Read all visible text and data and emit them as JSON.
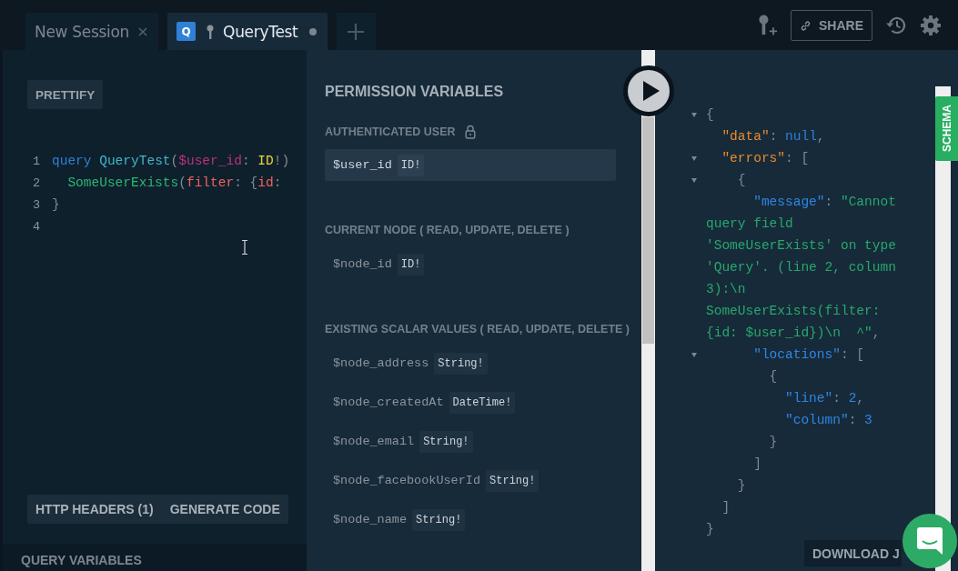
{
  "tabs": [
    {
      "label": "New Session",
      "selected": false,
      "unsaved": false,
      "auth": false
    },
    {
      "label": "QueryTest",
      "selected": true,
      "unsaved": true,
      "auth": true,
      "badge": "Q"
    }
  ],
  "toolbar": {
    "share": "SHARE"
  },
  "editor": {
    "prettify": "PRETTIFY",
    "lines": [
      {
        "number": "1",
        "tokens": [
          {
            "text": "query ",
            "kind": "keyword"
          },
          {
            "text": "QueryTest",
            "kind": "def"
          },
          {
            "text": "(",
            "kind": "punct"
          },
          {
            "text": "$user_id",
            "kind": "variable"
          },
          {
            "text": ": ",
            "kind": "punct"
          },
          {
            "text": "ID",
            "kind": "type"
          },
          {
            "text": "!)",
            "kind": "punct"
          }
        ]
      },
      {
        "number": "2",
        "tokens": [
          {
            "text": "  SomeUserExists",
            "kind": "field"
          },
          {
            "text": "(",
            "kind": "punct"
          },
          {
            "text": "filter",
            "kind": "attribute"
          },
          {
            "text": ": {",
            "kind": "punct"
          },
          {
            "text": "id",
            "kind": "attribute"
          },
          {
            "text": ":",
            "kind": "punct"
          }
        ]
      },
      {
        "number": "3",
        "tokens": [
          {
            "text": "}",
            "kind": "punct"
          }
        ]
      },
      {
        "number": "4"
      }
    ],
    "bottom_buttons": [
      "HTTP HEADERS (1)",
      "GENERATE CODE"
    ],
    "query_variables": "QUERY VARIABLES"
  },
  "permissions": {
    "title": "PERMISSION VARIABLES",
    "sections": [
      {
        "label": "AUTHENTICATED USER",
        "locked": true,
        "variables": [
          {
            "name": "$user_id",
            "type": "ID!",
            "selected": true
          }
        ]
      },
      {
        "label": "CURRENT NODE ( **READ, UPDATE, DELETE** )",
        "locked": false,
        "variables": [
          {
            "name": "$node_id",
            "type": "ID!",
            "selected": false
          }
        ]
      },
      {
        "label": "EXISTING SCALAR VALUES ( **READ, UPDATE, DELETE** )",
        "locked": false,
        "variables": [
          {
            "name": "$node_address",
            "type": "String!",
            "selected": false
          },
          {
            "name": "$node_createdAt",
            "type": "DateTime!",
            "selected": false
          },
          {
            "name": "$node_email",
            "type": "String!",
            "selected": false
          },
          {
            "name": "$node_facebookUserId",
            "type": "String!",
            "selected": false
          },
          {
            "name": "$node_name",
            "type": "String!",
            "selected": false
          }
        ]
      }
    ]
  },
  "result": {
    "schema_tab": "SCHEMA",
    "download": "DOWNLOAD J",
    "lines": [
      {
        "foldable": true,
        "tokens": [
          {
            "text": "{",
            "kind": "punct"
          }
        ]
      },
      {
        "foldable": false,
        "tokens": [
          {
            "text": "  \"data\"",
            "kind": "key"
          },
          {
            "text": ": ",
            "kind": "punct"
          },
          {
            "text": "null",
            "kind": "keyword"
          },
          {
            "text": ",",
            "kind": "punct"
          }
        ]
      },
      {
        "foldable": true,
        "tokens": [
          {
            "text": "  \"errors\"",
            "kind": "key"
          },
          {
            "text": ": [",
            "kind": "punct"
          }
        ]
      },
      {
        "foldable": true,
        "tokens": [
          {
            "text": "    {",
            "kind": "punct"
          }
        ]
      },
      {
        "foldable": false,
        "tokens": [
          {
            "text": "      \"message\"",
            "kind": "nested-key"
          },
          {
            "text": ": ",
            "kind": "punct"
          },
          {
            "text": "\"Cannot",
            "kind": "string"
          }
        ]
      },
      {
        "foldable": false,
        "tokens": [
          {
            "text": "query field",
            "kind": "string"
          }
        ]
      },
      {
        "foldable": false,
        "tokens": [
          {
            "text": "'SomeUserExists' on type",
            "kind": "string"
          }
        ]
      },
      {
        "foldable": false,
        "tokens": [
          {
            "text": "'Query'. (line 2, column",
            "kind": "string"
          }
        ]
      },
      {
        "foldable": false,
        "tokens": [
          {
            "text": "3):\\n",
            "kind": "string"
          }
        ]
      },
      {
        "foldable": false,
        "tokens": [
          {
            "text": "SomeUserExists(filter:",
            "kind": "string"
          }
        ]
      },
      {
        "foldable": false,
        "tokens": [
          {
            "text": "{id: $user_id})\\n  ^\"",
            "kind": "string"
          },
          {
            "text": ",",
            "kind": "punct"
          }
        ]
      },
      {
        "foldable": true,
        "tokens": [
          {
            "text": "      \"locations\"",
            "kind": "nested-key"
          },
          {
            "text": ": [",
            "kind": "punct"
          }
        ]
      },
      {
        "foldable": false,
        "tokens": [
          {
            "text": "        {",
            "kind": "punct"
          }
        ]
      },
      {
        "foldable": false,
        "tokens": [
          {
            "text": "          \"line\"",
            "kind": "nested-key"
          },
          {
            "text": ": ",
            "kind": "punct"
          },
          {
            "text": "2",
            "kind": "number"
          },
          {
            "text": ",",
            "kind": "punct"
          }
        ]
      },
      {
        "foldable": false,
        "tokens": [
          {
            "text": "          \"column\"",
            "kind": "nested-key"
          },
          {
            "text": ": ",
            "kind": "punct"
          },
          {
            "text": "3",
            "kind": "number"
          }
        ]
      },
      {
        "foldable": false,
        "tokens": [
          {
            "text": "        }",
            "kind": "punct"
          }
        ]
      },
      {
        "foldable": false,
        "tokens": [
          {
            "text": "      ]",
            "kind": "punct"
          }
        ]
      },
      {
        "foldable": false,
        "tokens": [
          {
            "text": "    }",
            "kind": "punct"
          }
        ]
      },
      {
        "foldable": false,
        "tokens": [
          {
            "text": "  ]",
            "kind": "punct"
          }
        ]
      },
      {
        "foldable": false,
        "tokens": [
          {
            "text": "}",
            "kind": "punct"
          }
        ]
      }
    ]
  }
}
